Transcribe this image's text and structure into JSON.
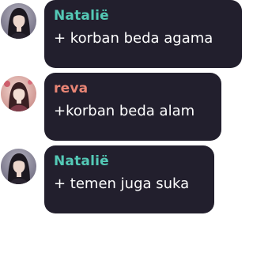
{
  "colors": {
    "bubble_bg": "#221f2d",
    "message_text": "#ffffff"
  },
  "messages": [
    {
      "author": "Natalië",
      "author_color": "#54c9b6",
      "avatar": "natalie-avatar",
      "text": "+ korban beda agama"
    },
    {
      "author": "reva",
      "author_color": "#e98575",
      "avatar": "reva-avatar",
      "text": "+korban beda alam"
    },
    {
      "author": "Natalië",
      "author_color": "#54c9b6",
      "avatar": "natalie-avatar",
      "text": "+ temen juga suka"
    }
  ]
}
